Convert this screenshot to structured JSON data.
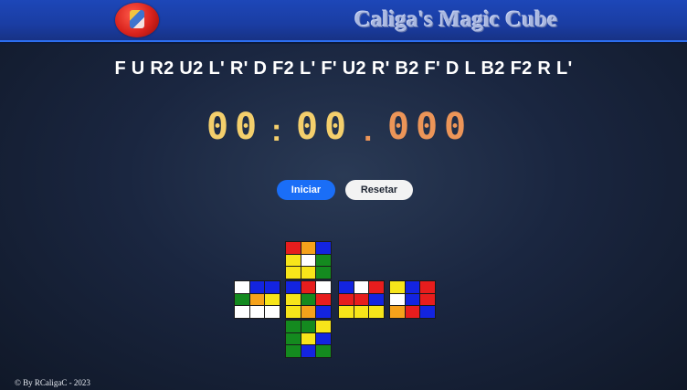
{
  "header": {
    "title": "Caliga's Magic Cube",
    "logo_icon": "cube-logo-icon"
  },
  "scramble": "F U R2 U2 L' R' D F2 L' F' U2 R' B2 F' D L B2 F2 R L'",
  "timer": {
    "minutes": [
      "0",
      "0"
    ],
    "seconds": [
      "0",
      "0"
    ],
    "millis": [
      "0",
      "0",
      "0"
    ],
    "separator_1": ":",
    "separator_2": ".",
    "colors": {
      "minutes_seconds": "#f4cf6c",
      "millis": "#ec9558"
    }
  },
  "buttons": {
    "start_label": "Iniciar",
    "reset_label": "Resetar"
  },
  "colors": {
    "W": "#ffffff",
    "Y": "#f7e51a",
    "R": "#e71d1d",
    "O": "#f5a21b",
    "B": "#1324e0",
    "G": "#148a1f"
  },
  "cube": {
    "top": [
      "R",
      "O",
      "B",
      "Y",
      "W",
      "G",
      "Y",
      "Y",
      "G"
    ],
    "left": [
      "W",
      "B",
      "B",
      "G",
      "O",
      "Y",
      "W",
      "W",
      "W"
    ],
    "front": [
      "B",
      "R",
      "W",
      "Y",
      "G",
      "R",
      "Y",
      "O",
      "B"
    ],
    "right": [
      "B",
      "W",
      "R",
      "R",
      "R",
      "B",
      "Y",
      "Y",
      "Y"
    ],
    "back": [
      "Y",
      "B",
      "R",
      "W",
      "B",
      "R",
      "O",
      "R",
      "B"
    ],
    "bottom": [
      "G",
      "G",
      "Y",
      "G",
      "Y",
      "B",
      "G",
      "B",
      "G"
    ]
  },
  "footer": "© By RCaligaC - 2023"
}
